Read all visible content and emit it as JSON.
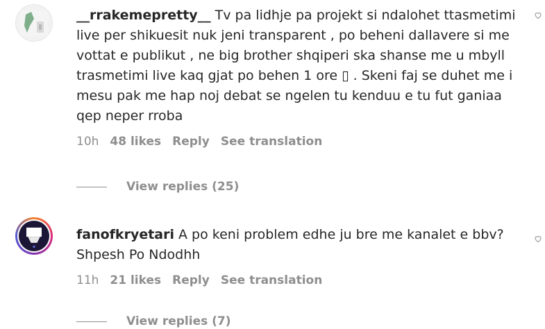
{
  "comments": [
    {
      "username": "__rrakemepretty__",
      "text": "Tv pa lidhje pa projekt si ndalohet ttasmetimi live per shikuesit nuk jeni transparent , po beheni dallavere si me vottat e publikut , ne big brother shqiperi ska shanse me u mbyll trasmetimi live kaq gjat po behen 1 ore ▯ . Skeni faj se duhet me i mesu pak me hap noj debat se ngelen tu kenduu e tu fut ganiaa qep neper rroba",
      "time": "10h",
      "likes": "48 likes",
      "reply_label": "Reply",
      "translate_label": "See translation",
      "view_replies": "View replies (25)"
    },
    {
      "username": "fanofkryetari",
      "text": "A po keni problem edhe ju bre me kanalet e bbv? Shpesh Po Ndodhh",
      "time": "11h",
      "likes": "21 likes",
      "reply_label": "Reply",
      "translate_label": "See translation",
      "view_replies": "View replies (7)"
    }
  ],
  "icons": {
    "like": "heart-outline-icon"
  },
  "colors": {
    "text": "#262626",
    "secondary": "#8e8e8e"
  }
}
